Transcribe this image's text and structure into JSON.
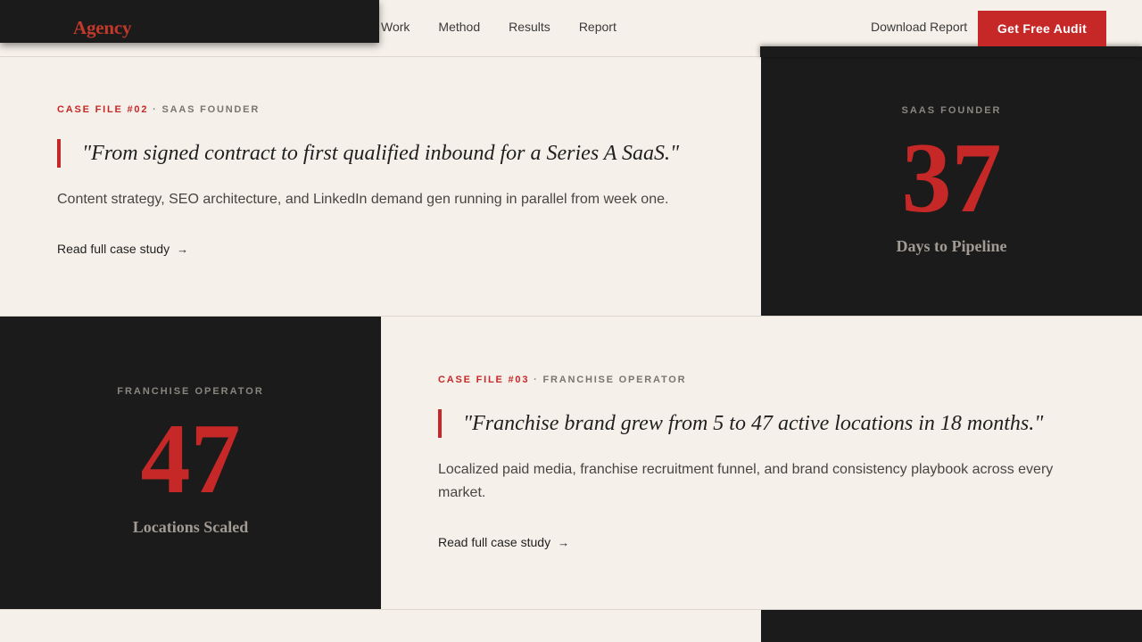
{
  "header": {
    "logo": "Agency",
    "nav": [
      "Work",
      "Method",
      "Results",
      "Report"
    ],
    "download_label": "Download Report",
    "cta_label": "Get Free Audit"
  },
  "cases": [
    {
      "file_label": "CASE FILE #02",
      "separator": "·",
      "segment": "SAAS FOUNDER",
      "quote": "\"From signed contract to first qualified inbound for a Series A SaaS.\"",
      "description": "Content strategy, SEO architecture, and LinkedIn demand gen running in parallel from week one.",
      "link_label": "Read full case study",
      "stat_tag": "SAAS FOUNDER",
      "stat_value": "37",
      "stat_label": "Days to Pipeline"
    },
    {
      "file_label": "CASE FILE #03",
      "separator": "·",
      "segment": "FRANCHISE OPERATOR",
      "quote": "\"Franchise brand grew from 5 to 47 active locations in 18 months.\"",
      "description": "Localized paid media, franchise recruitment funnel, and brand consistency playbook across every market.",
      "link_label": "Read full case study",
      "stat_tag": "FRANCHISE OPERATOR",
      "stat_value": "47",
      "stat_label": "Locations Scaled"
    }
  ],
  "icons": {
    "arrow": "arrow-right-icon"
  },
  "colors": {
    "accent": "#c62828",
    "dark_panel": "#1b1b1b",
    "background": "#f5f0e9"
  }
}
